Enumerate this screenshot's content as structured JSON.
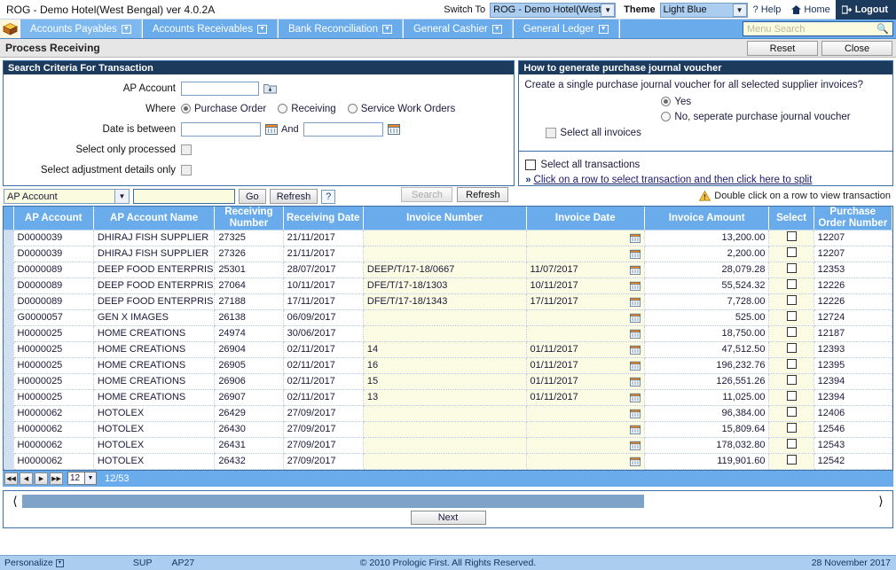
{
  "topbar": {
    "app_title": "ROG - Demo Hotel(West Bengal) ver 4.0.2A",
    "switch_label": "Switch To",
    "switch_value": "ROG - Demo Hotel(West",
    "theme_label": "Theme",
    "theme_value": "Light Blue",
    "help": "Help",
    "home": "Home",
    "logout": "Logout"
  },
  "menubar": {
    "items": [
      {
        "label": "Accounts Payables",
        "active": true
      },
      {
        "label": "Accounts Receivables",
        "active": false
      },
      {
        "label": "Bank Reconciliation",
        "active": false
      },
      {
        "label": "General Cashier",
        "active": false
      },
      {
        "label": "General Ledger",
        "active": false
      }
    ],
    "search_placeholder": "Menu Search"
  },
  "pagehead": {
    "title": "Process Receiving",
    "reset": "Reset",
    "close": "Close"
  },
  "criteria": {
    "panel_title": "Search Criteria For Transaction",
    "ap_account_label": "AP Account",
    "ap_account_value": "",
    "where_label": "Where",
    "where_options": [
      {
        "label": "Purchase Order",
        "selected": true
      },
      {
        "label": "Receiving",
        "selected": false
      },
      {
        "label": "Service Work Orders",
        "selected": false
      }
    ],
    "date_label": "Date is between",
    "date_from": "",
    "and_label": "And",
    "date_to": "",
    "only_processed_label": "Select only processed",
    "only_processed_checked": false,
    "adjustment_label": "Select adjustment details only",
    "adjustment_checked": false,
    "search_btn": "Search",
    "refresh_btn": "Refresh"
  },
  "voucher": {
    "panel_title": "How to generate purchase journal voucher",
    "question": "Create a single purchase journal voucher for all selected supplier invoices?",
    "options": [
      {
        "label": "Yes",
        "selected": true
      },
      {
        "label": "No, seperate purchase journal voucher",
        "selected": false
      }
    ],
    "select_all_invoices": "Select all invoices",
    "select_all_invoices_checked": false,
    "select_all_transactions": "Select all transactions",
    "select_all_transactions_checked": false,
    "split_link": "Click on a row to select transaction and then click here to split"
  },
  "filterbar": {
    "field_value": "AP Account",
    "text_value": "",
    "go": "Go",
    "refresh": "Refresh",
    "help": "?",
    "note": "Double click on a row to view transaction"
  },
  "grid": {
    "columns": [
      "AP Account",
      "AP Account Name",
      "Receiving Number",
      "Receiving Date",
      "Invoice Number",
      "Invoice Date",
      "Invoice Amount",
      "Select",
      "Purchase Order Number"
    ],
    "rows": [
      {
        "ap_account": "D0000039",
        "ap_account_name": "DHIRAJ FISH SUPPLIER",
        "receiving_number": "27325",
        "receiving_date": "21/11/2017",
        "invoice_number": "",
        "invoice_date": "",
        "invoice_amount": "13,200.00",
        "selected": false,
        "po_number": "12207"
      },
      {
        "ap_account": "D0000039",
        "ap_account_name": "DHIRAJ FISH SUPPLIER",
        "receiving_number": "27326",
        "receiving_date": "21/11/2017",
        "invoice_number": "",
        "invoice_date": "",
        "invoice_amount": "2,200.00",
        "selected": false,
        "po_number": "12207"
      },
      {
        "ap_account": "D0000089",
        "ap_account_name": "DEEP FOOD ENTERPRIS",
        "receiving_number": "25301",
        "receiving_date": "28/07/2017",
        "invoice_number": "DEEP/T/17-18/0667",
        "invoice_date": "11/07/2017",
        "invoice_amount": "28,079.28",
        "selected": false,
        "po_number": "12353"
      },
      {
        "ap_account": "D0000089",
        "ap_account_name": "DEEP FOOD ENTERPRIS",
        "receiving_number": "27064",
        "receiving_date": "10/11/2017",
        "invoice_number": "DFE/T/17-18/1303",
        "invoice_date": "10/11/2017",
        "invoice_amount": "55,524.32",
        "selected": false,
        "po_number": "12226"
      },
      {
        "ap_account": "D0000089",
        "ap_account_name": "DEEP FOOD ENTERPRIS",
        "receiving_number": "27188",
        "receiving_date": "17/11/2017",
        "invoice_number": "DFE/T/17-18/1343",
        "invoice_date": "17/11/2017",
        "invoice_amount": "7,728.00",
        "selected": false,
        "po_number": "12226"
      },
      {
        "ap_account": "G0000057",
        "ap_account_name": "GEN X IMAGES",
        "receiving_number": "26138",
        "receiving_date": "06/09/2017",
        "invoice_number": "",
        "invoice_date": "",
        "invoice_amount": "525.00",
        "selected": false,
        "po_number": "12724"
      },
      {
        "ap_account": "H0000025",
        "ap_account_name": "HOME CREATIONS",
        "receiving_number": "24974",
        "receiving_date": "30/06/2017",
        "invoice_number": "",
        "invoice_date": "",
        "invoice_amount": "18,750.00",
        "selected": false,
        "po_number": "12187"
      },
      {
        "ap_account": "H0000025",
        "ap_account_name": "HOME CREATIONS",
        "receiving_number": "26904",
        "receiving_date": "02/11/2017",
        "invoice_number": "14",
        "invoice_date": "01/11/2017",
        "invoice_amount": "47,512.50",
        "selected": false,
        "po_number": "12393"
      },
      {
        "ap_account": "H0000025",
        "ap_account_name": "HOME CREATIONS",
        "receiving_number": "26905",
        "receiving_date": "02/11/2017",
        "invoice_number": "16",
        "invoice_date": "01/11/2017",
        "invoice_amount": "196,232.76",
        "selected": false,
        "po_number": "12395"
      },
      {
        "ap_account": "H0000025",
        "ap_account_name": "HOME CREATIONS",
        "receiving_number": "26906",
        "receiving_date": "02/11/2017",
        "invoice_number": "15",
        "invoice_date": "01/11/2017",
        "invoice_amount": "126,551.26",
        "selected": false,
        "po_number": "12394"
      },
      {
        "ap_account": "H0000025",
        "ap_account_name": "HOME CREATIONS",
        "receiving_number": "26907",
        "receiving_date": "02/11/2017",
        "invoice_number": "13",
        "invoice_date": "01/11/2017",
        "invoice_amount": "11,025.00",
        "selected": false,
        "po_number": "12394"
      },
      {
        "ap_account": "H0000062",
        "ap_account_name": "HOTOLEX",
        "receiving_number": "26429",
        "receiving_date": "27/09/2017",
        "invoice_number": "",
        "invoice_date": "",
        "invoice_amount": "96,384.00",
        "selected": false,
        "po_number": "12406"
      },
      {
        "ap_account": "H0000062",
        "ap_account_name": "HOTOLEX",
        "receiving_number": "26430",
        "receiving_date": "27/09/2017",
        "invoice_number": "",
        "invoice_date": "",
        "invoice_amount": "15,809.64",
        "selected": false,
        "po_number": "12546"
      },
      {
        "ap_account": "H0000062",
        "ap_account_name": "HOTOLEX",
        "receiving_number": "26431",
        "receiving_date": "27/09/2017",
        "invoice_number": "",
        "invoice_date": "",
        "invoice_amount": "178,032.80",
        "selected": false,
        "po_number": "12543"
      },
      {
        "ap_account": "H0000062",
        "ap_account_name": "HOTOLEX",
        "receiving_number": "26432",
        "receiving_date": "27/09/2017",
        "invoice_number": "",
        "invoice_date": "",
        "invoice_amount": "119,901.60",
        "selected": false,
        "po_number": "12542"
      }
    ]
  },
  "pager": {
    "page_size": "12",
    "info": "12/53"
  },
  "bottom": {
    "next": "Next"
  },
  "footer": {
    "personalize": "Personalize",
    "sup": "SUP",
    "ap": "AP27",
    "copyright": "© 2010 Prologic First. All Rights Reserved.",
    "date": "28 November 2017"
  }
}
